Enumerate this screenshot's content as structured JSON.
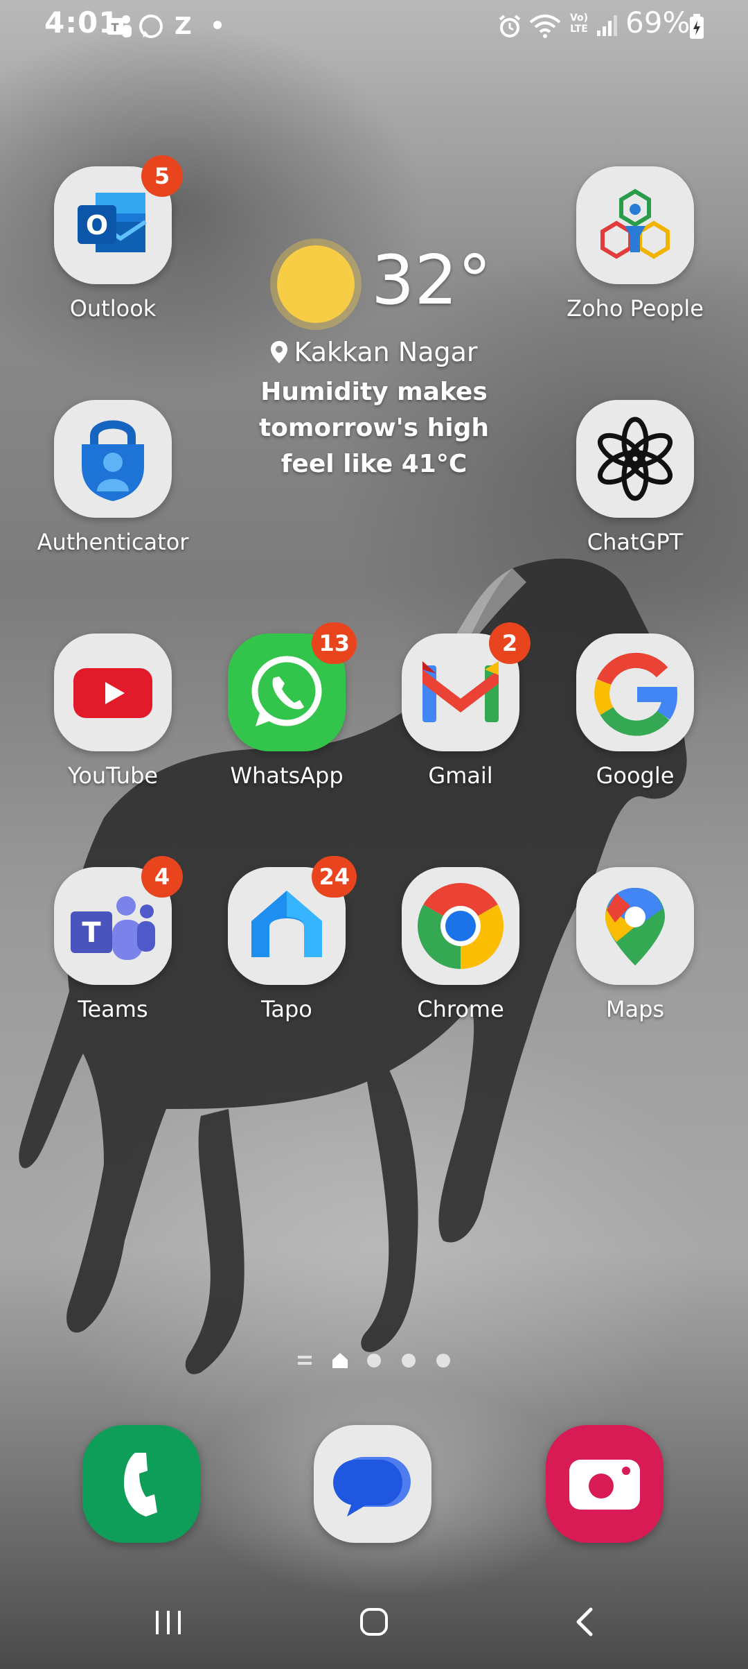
{
  "status_bar": {
    "time": "4:01",
    "notification_icons": [
      "teams-icon",
      "whatsapp-icon",
      "zoho-icon",
      "dot-icon"
    ],
    "notification_z": "Z",
    "system_icons": [
      "alarm-icon",
      "wifi-icon",
      "volte-icon",
      "signal-icon",
      "battery-charging-icon"
    ],
    "volte_text": "Vo) LTE",
    "battery_percent": "69%"
  },
  "weather": {
    "temperature": "32°",
    "location": "Kakkan Nagar",
    "message": "Humidity makes tomorrow's high feel like 41°C",
    "icon": "sun-icon",
    "sun_color": "#f6cd45"
  },
  "apps": [
    {
      "name": "Outlook",
      "badge": "5",
      "icon": "outlook-icon"
    },
    {
      "name": "Zoho People",
      "badge": "",
      "icon": "zoho-people-icon"
    },
    {
      "name": "Authenticator",
      "badge": "",
      "icon": "authenticator-icon"
    },
    {
      "name": "ChatGPT",
      "badge": "",
      "icon": "chatgpt-icon"
    },
    {
      "name": "YouTube",
      "badge": "",
      "icon": "youtube-icon"
    },
    {
      "name": "WhatsApp",
      "badge": "13",
      "icon": "whatsapp-icon"
    },
    {
      "name": "Gmail",
      "badge": "2",
      "icon": "gmail-icon"
    },
    {
      "name": "Google",
      "badge": "",
      "icon": "google-icon"
    },
    {
      "name": "Teams",
      "badge": "4",
      "icon": "teams-icon"
    },
    {
      "name": "Tapo",
      "badge": "24",
      "icon": "tapo-icon"
    },
    {
      "name": "Chrome",
      "badge": "",
      "icon": "chrome-icon"
    },
    {
      "name": "Maps",
      "badge": "",
      "icon": "maps-icon"
    }
  ],
  "dock": [
    {
      "app": "phone",
      "icon": "phone-icon",
      "color": "#0f9d5a"
    },
    {
      "app": "messages",
      "icon": "messages-icon",
      "color": "#e9e9ea"
    },
    {
      "app": "camera",
      "icon": "camera-icon",
      "color": "#d81b55"
    }
  ],
  "page_indicator": {
    "pages": 4,
    "current": 1,
    "icons": [
      "menu-lines-icon",
      "home-icon",
      "page-dot-icon",
      "page-dot-icon",
      "page-dot-icon"
    ]
  },
  "navigation_bar": {
    "buttons": [
      "recents-button",
      "home-button",
      "back-button"
    ]
  },
  "colors": {
    "badge": "#e8451e"
  }
}
